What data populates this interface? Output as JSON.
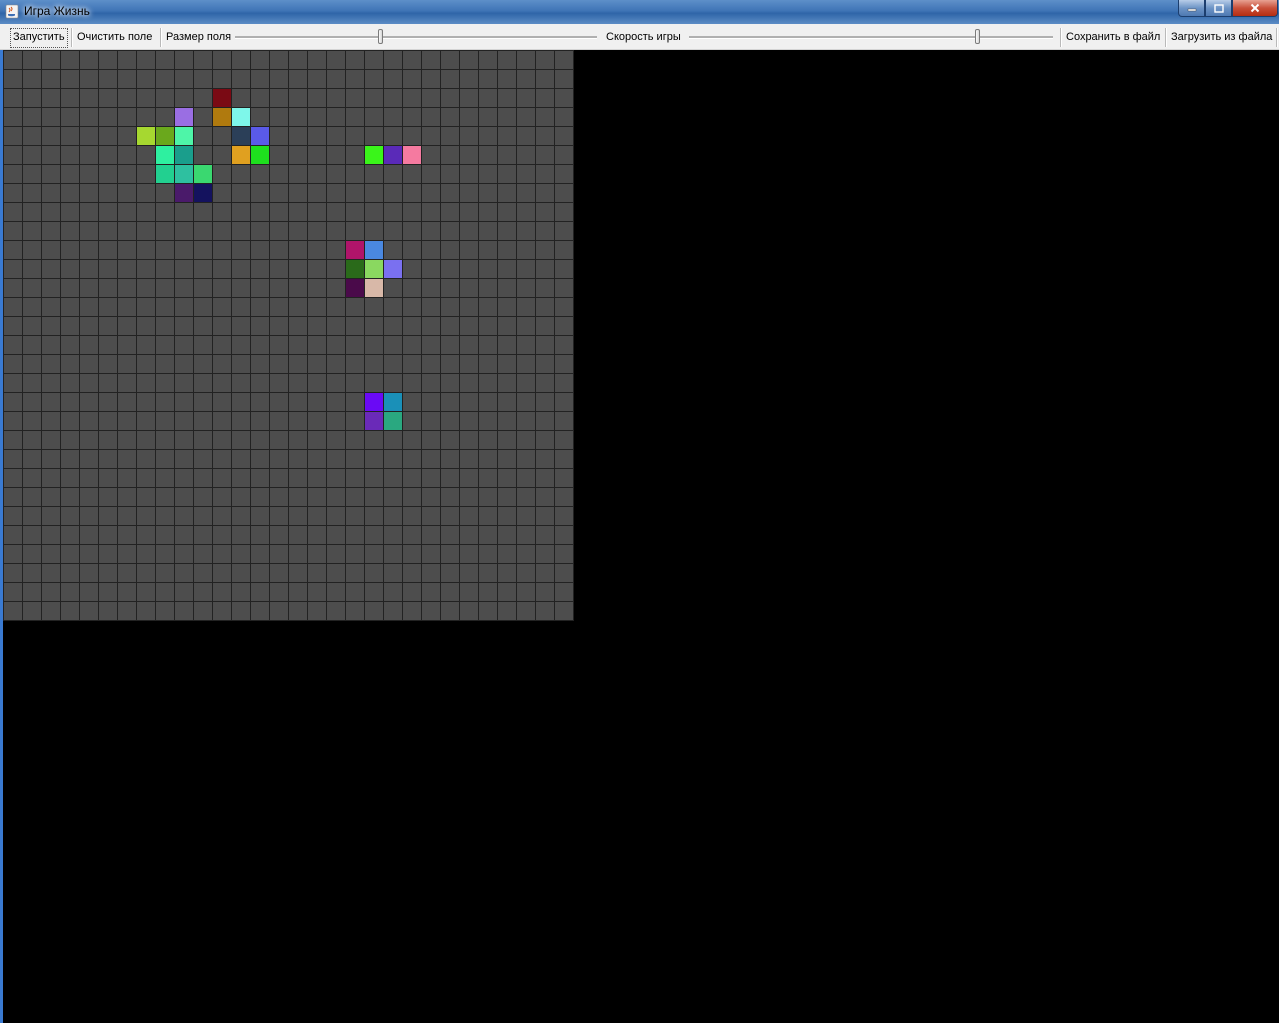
{
  "window": {
    "title": "Игра Жизнь",
    "icon": "java-cup-icon",
    "controls": [
      "minimize-icon",
      "maximize-icon",
      "close-icon"
    ]
  },
  "toolbar": {
    "start_label": "Запустить",
    "clear_label": "Очистить поле",
    "size_label": "Размер поля",
    "speed_label": "Скорость игры",
    "save_label": "Сохранить в файл",
    "load_label": "Загрузить из файла",
    "size_slider_value": 0.4,
    "speed_slider_value": 0.79
  },
  "board": {
    "columns": 30,
    "rows": 30,
    "empty_color": "#4d4d4d",
    "grid_color": "#222222",
    "live_cells": [
      {
        "col": 11,
        "row": 2,
        "color": "#7a0a14"
      },
      {
        "col": 9,
        "row": 3,
        "color": "#9a6ee3"
      },
      {
        "col": 11,
        "row": 3,
        "color": "#b07a0e"
      },
      {
        "col": 12,
        "row": 3,
        "color": "#7ef7ea"
      },
      {
        "col": 7,
        "row": 4,
        "color": "#a6d830"
      },
      {
        "col": 8,
        "row": 4,
        "color": "#6aa81c"
      },
      {
        "col": 9,
        "row": 4,
        "color": "#4ef5a8"
      },
      {
        "col": 12,
        "row": 4,
        "color": "#2b3f58"
      },
      {
        "col": 13,
        "row": 4,
        "color": "#5a5ae8"
      },
      {
        "col": 8,
        "row": 5,
        "color": "#2ef0a0"
      },
      {
        "col": 9,
        "row": 5,
        "color": "#1a9e8c"
      },
      {
        "col": 12,
        "row": 5,
        "color": "#e0a020"
      },
      {
        "col": 13,
        "row": 5,
        "color": "#1ee01e"
      },
      {
        "col": 19,
        "row": 5,
        "color": "#3af51a"
      },
      {
        "col": 20,
        "row": 5,
        "color": "#5a2ab8"
      },
      {
        "col": 21,
        "row": 5,
        "color": "#f57aa0"
      },
      {
        "col": 8,
        "row": 6,
        "color": "#22d090"
      },
      {
        "col": 9,
        "row": 6,
        "color": "#2ec0a0"
      },
      {
        "col": 10,
        "row": 6,
        "color": "#3ad870"
      },
      {
        "col": 9,
        "row": 7,
        "color": "#4a1a6a"
      },
      {
        "col": 10,
        "row": 7,
        "color": "#14125e"
      },
      {
        "col": 18,
        "row": 10,
        "color": "#b0146a"
      },
      {
        "col": 19,
        "row": 10,
        "color": "#4a88e0"
      },
      {
        "col": 18,
        "row": 11,
        "color": "#2a6a1a"
      },
      {
        "col": 19,
        "row": 11,
        "color": "#8ad860"
      },
      {
        "col": 20,
        "row": 11,
        "color": "#7a70f0"
      },
      {
        "col": 18,
        "row": 12,
        "color": "#4a0a4a"
      },
      {
        "col": 19,
        "row": 12,
        "color": "#d8b8a8"
      },
      {
        "col": 19,
        "row": 18,
        "color": "#6a0af5"
      },
      {
        "col": 20,
        "row": 18,
        "color": "#1a90b8"
      },
      {
        "col": 19,
        "row": 19,
        "color": "#6a2ab8"
      },
      {
        "col": 20,
        "row": 19,
        "color": "#2aa880"
      }
    ]
  }
}
